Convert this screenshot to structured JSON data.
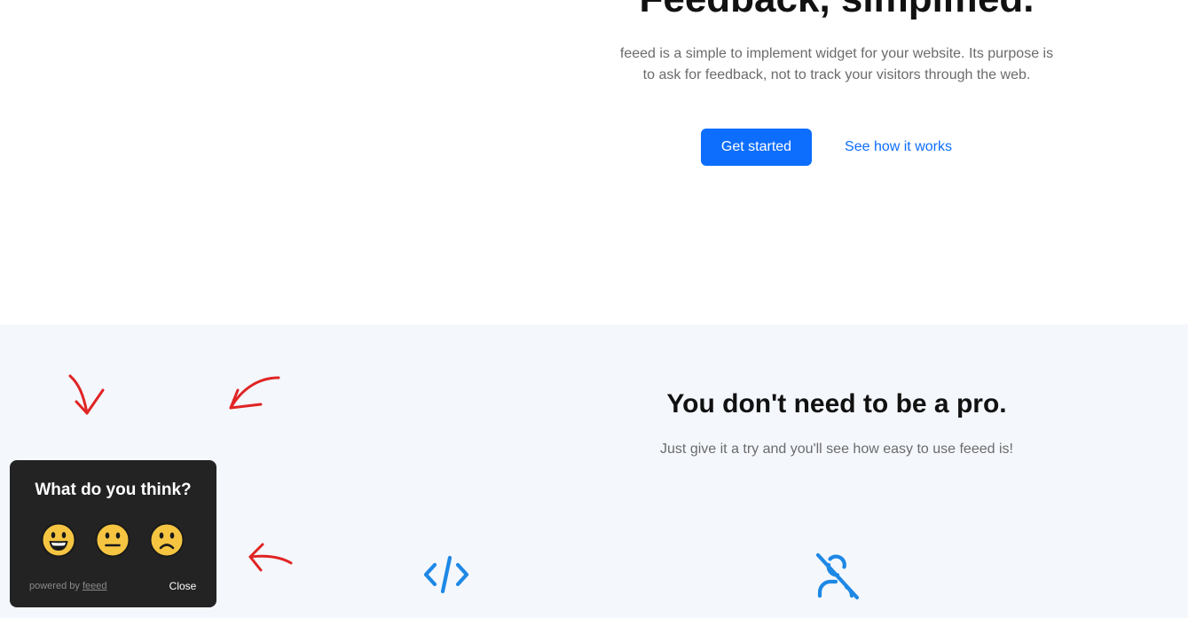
{
  "hero": {
    "title": "Feedback, simplified.",
    "description": "feeed is a simple to implement widget for your website. Its purpose is to ask for feedback, not to track your visitors through the web.",
    "primary_button": "Get started",
    "secondary_link": "See how it works"
  },
  "features": {
    "title": "You don't need to be a pro.",
    "subtitle": "Just give it a try and you'll see how easy to use feeed is!",
    "icons": [
      "code-icon",
      "user-off-icon"
    ]
  },
  "widget": {
    "question": "What do you think?",
    "emojis": [
      {
        "name": "happy-emoji-icon",
        "label": "Good"
      },
      {
        "name": "neutral-emoji-icon",
        "label": "Okay"
      },
      {
        "name": "sad-emoji-icon",
        "label": "Bad"
      }
    ],
    "powered_prefix": "powered by",
    "powered_link": "feeed",
    "close_label": "Close"
  },
  "colors": {
    "primary": "#0d6efd",
    "feature_icon": "#1e88e5",
    "annotation_arrow": "#e02424",
    "widget_bg": "#232323",
    "section_bg": "#f4f7fc",
    "emoji_fill": "#f5c542"
  }
}
